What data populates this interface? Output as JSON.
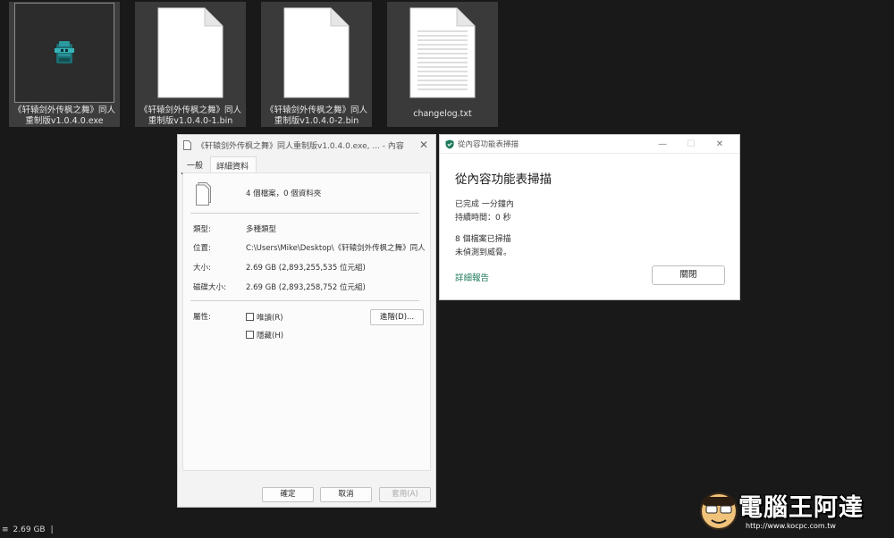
{
  "files": [
    {
      "name": "《轩辕剑外传枫之舞》同人重制版v1.0.4.0.exe",
      "icon": "exe-app-icon"
    },
    {
      "name": "《轩辕剑外传枫之舞》同人重制版v1.0.4.0-1.bin",
      "icon": "blank-file-icon"
    },
    {
      "name": "《轩辕剑外传枫之舞》同人重制版v1.0.4.0-2.bin",
      "icon": "blank-file-icon"
    },
    {
      "name": "changelog.txt",
      "icon": "text-file-icon"
    }
  ],
  "properties": {
    "title": "《轩辕剑外传枫之舞》同人重制版v1.0.4.0.exe, ... - 內容",
    "tabs": [
      "一般",
      "詳細資料"
    ],
    "summary": "4 個檔案，0 個資料夾",
    "type_label": "類型:",
    "type_value": "多種類型",
    "location_label": "位置:",
    "location_value": "C:\\Users\\Mike\\Desktop\\《轩辕剑外传枫之舞》同人",
    "size_label": "大小:",
    "size_value": "2.69 GB (2,893,255,535 位元組)",
    "disk_size_label": "磁碟大小:",
    "disk_size_value": "2.69 GB (2,893,258,752 位元組)",
    "attributes_label": "屬性:",
    "readonly_label": "唯讀(R)",
    "hidden_label": "隱藏(H)",
    "advanced_label": "進階(D)...",
    "ok_label": "確定",
    "cancel_label": "取消",
    "apply_label": "套用(A)"
  },
  "scan": {
    "window_title": "從內容功能表掃描",
    "heading": "從內容功能表掃描",
    "completed": "已完成 一分鐘內",
    "duration": "持續時間：0 秒",
    "scanned": "8 個檔案已掃描",
    "threats": "未偵測到威脅。",
    "report_link": "詳細報告",
    "close_label": "關閉",
    "accent_color": "#1f7a5c"
  },
  "status_bar": {
    "size": "2.69 GB"
  },
  "watermark": {
    "text": "電腦王阿達",
    "url": "http://www.kocpc.com.tw"
  }
}
